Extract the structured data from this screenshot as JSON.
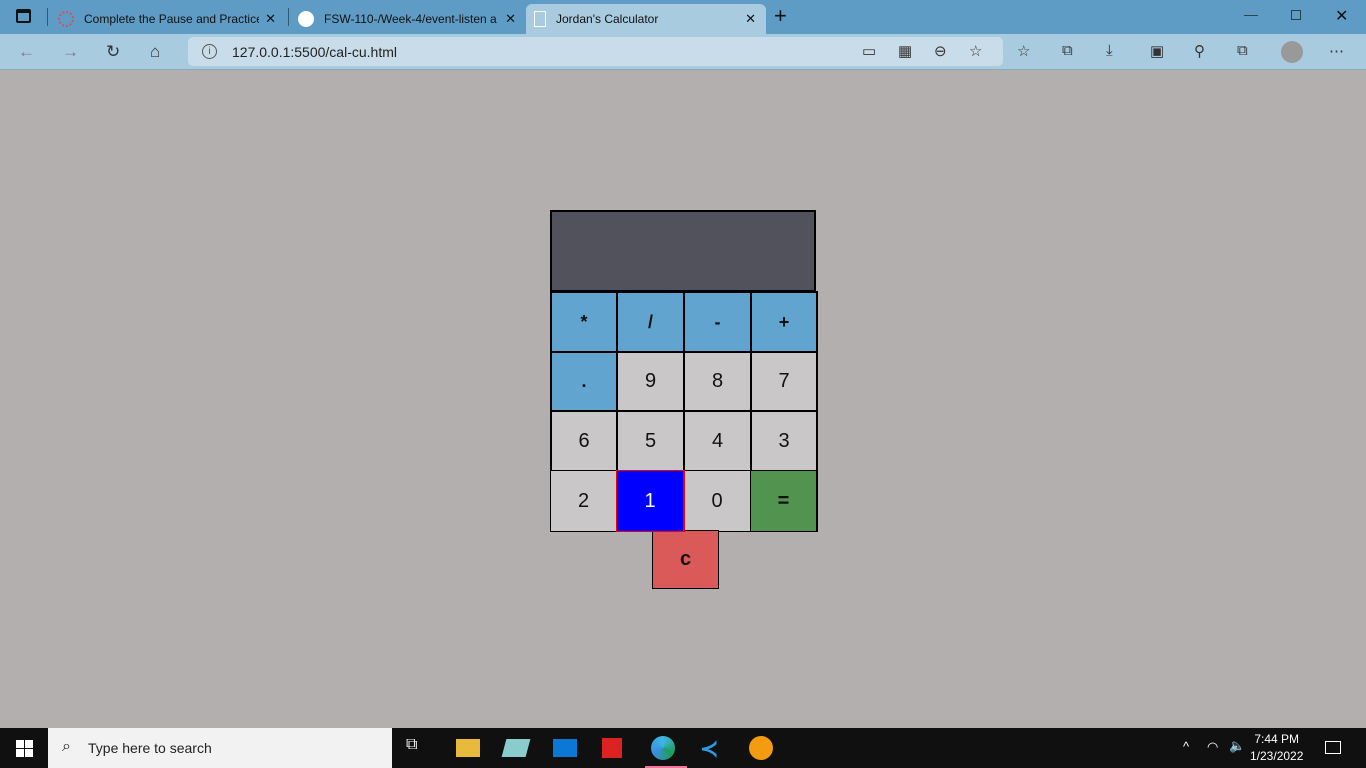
{
  "browser": {
    "tabs": [
      {
        "title": "Complete the Pause and Practice",
        "icon": "loading-icon"
      },
      {
        "title": "FSW-110-/Week-4/event-listen a",
        "icon": "github-icon"
      },
      {
        "title": "Jordan's Calculator",
        "icon": "page-icon",
        "active": true
      }
    ],
    "url": "127.0.0.1:5500/cal-cu.html"
  },
  "calculator": {
    "display": "",
    "rows": [
      [
        {
          "label": "*",
          "type": "op"
        },
        {
          "label": "/",
          "type": "op"
        },
        {
          "label": "-",
          "type": "op"
        },
        {
          "label": "+",
          "type": "op"
        }
      ],
      [
        {
          "label": ".",
          "type": "op"
        },
        {
          "label": "9",
          "type": "num"
        },
        {
          "label": "8",
          "type": "num"
        },
        {
          "label": "7",
          "type": "num"
        }
      ],
      [
        {
          "label": "6",
          "type": "num"
        },
        {
          "label": "5",
          "type": "num"
        },
        {
          "label": "4",
          "type": "num"
        },
        {
          "label": "3",
          "type": "num"
        }
      ],
      [
        {
          "label": "2",
          "type": "num"
        },
        {
          "label": "1",
          "type": "active"
        },
        {
          "label": "0",
          "type": "num"
        },
        {
          "label": "=",
          "type": "equals"
        }
      ]
    ],
    "clear": "c",
    "colors": {
      "op": "#62a4d0",
      "num": "#c9c7c7",
      "active": "#0000ff",
      "equals": "#52944f",
      "clear": "#da5959"
    }
  },
  "taskbar": {
    "search_placeholder": "Type here to search",
    "time": "7:44 PM",
    "date": "1/23/2022"
  }
}
